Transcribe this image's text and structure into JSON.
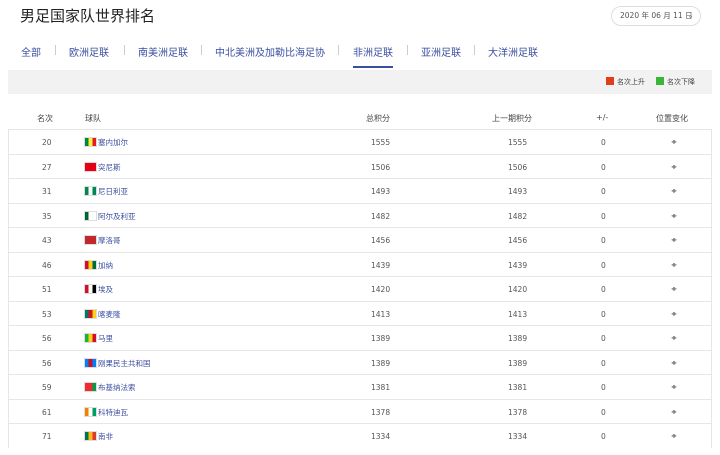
{
  "page_title": "男足国家队世界排名",
  "date_selector": {
    "value": "2020 年 06 月 11 日",
    "icon": "chevron-down-icon"
  },
  "tabs": [
    {
      "label": "全部"
    },
    {
      "label": "欧洲足联"
    },
    {
      "label": "南美洲足联"
    },
    {
      "label": "中北美洲及加勒比海足协"
    },
    {
      "label": "非洲足联",
      "active": true
    },
    {
      "label": "亚洲足联"
    },
    {
      "label": "大洋洲足联"
    }
  ],
  "legend": {
    "up": {
      "label": "名次上升",
      "color": "#e03d1a"
    },
    "down": {
      "label": "名次下降",
      "color": "#3ab53a"
    }
  },
  "columns": {
    "rank": "名次",
    "team": "球队",
    "points": "总积分",
    "prev_points": "上一期积分",
    "diff": "+/-",
    "change": "位置变化"
  },
  "rows": [
    {
      "rank": "20",
      "team": "塞内加尔",
      "points": "1555",
      "prev": "1555",
      "diff": "0",
      "flag": [
        "#00853f",
        "#fdef42",
        "#e31b23"
      ]
    },
    {
      "rank": "27",
      "team": "突尼斯",
      "points": "1506",
      "prev": "1506",
      "diff": "0",
      "flag": [
        "#e70013",
        "#e70013",
        "#e70013"
      ]
    },
    {
      "rank": "31",
      "team": "尼日利亚",
      "points": "1493",
      "prev": "1493",
      "diff": "0",
      "flag": [
        "#008751",
        "#ffffff",
        "#008751"
      ]
    },
    {
      "rank": "35",
      "team": "阿尔及利亚",
      "points": "1482",
      "prev": "1482",
      "diff": "0",
      "flag": [
        "#006233",
        "#ffffff",
        "#ffffff"
      ]
    },
    {
      "rank": "43",
      "team": "摩洛哥",
      "points": "1456",
      "prev": "1456",
      "diff": "0",
      "flag": [
        "#c1272d",
        "#c1272d",
        "#c1272d"
      ]
    },
    {
      "rank": "46",
      "team": "加纳",
      "points": "1439",
      "prev": "1439",
      "diff": "0",
      "flag": [
        "#ce1126",
        "#fcd116",
        "#006b3f"
      ]
    },
    {
      "rank": "51",
      "team": "埃及",
      "points": "1420",
      "prev": "1420",
      "diff": "0",
      "flag": [
        "#ce1126",
        "#ffffff",
        "#000000"
      ]
    },
    {
      "rank": "53",
      "team": "喀麦隆",
      "points": "1413",
      "prev": "1413",
      "diff": "0",
      "flag": [
        "#007a5e",
        "#ce1126",
        "#fcd116"
      ]
    },
    {
      "rank": "56",
      "team": "马里",
      "points": "1389",
      "prev": "1389",
      "diff": "0",
      "flag": [
        "#14b53a",
        "#fcd116",
        "#ce1126"
      ]
    },
    {
      "rank": "56",
      "team": "刚果民主共和国",
      "points": "1389",
      "prev": "1389",
      "diff": "0",
      "flag": [
        "#007fff",
        "#ce1021",
        "#007fff"
      ]
    },
    {
      "rank": "59",
      "team": "布基纳法索",
      "points": "1381",
      "prev": "1381",
      "diff": "0",
      "flag": [
        "#ef2b2d",
        "#ef2b2d",
        "#009e49"
      ]
    },
    {
      "rank": "61",
      "team": "科特迪瓦",
      "points": "1378",
      "prev": "1378",
      "diff": "0",
      "flag": [
        "#f77f00",
        "#ffffff",
        "#009e60"
      ]
    },
    {
      "rank": "71",
      "team": "南非",
      "points": "1334",
      "prev": "1334",
      "diff": "0",
      "flag": [
        "#007749",
        "#ffb81c",
        "#de3831"
      ]
    }
  ]
}
